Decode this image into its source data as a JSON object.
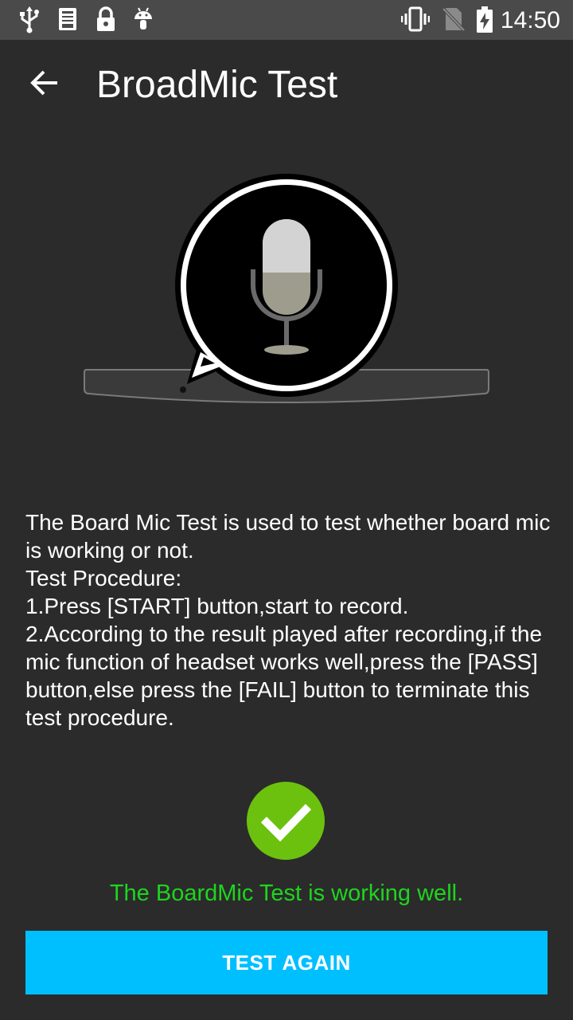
{
  "status_bar": {
    "time": "14:50",
    "icons": [
      "usb-icon",
      "debug-log-icon",
      "lock-icon",
      "android-icon",
      "vibrate-icon",
      "no-sim-icon",
      "battery-charging-icon"
    ]
  },
  "app_bar": {
    "back_icon": "arrow-back-icon",
    "title": "BroadMic Test"
  },
  "illustration": {
    "icon": "microphone-icon"
  },
  "description": {
    "lines": [
      "The Board Mic Test is used to test whether board mic is working or not.",
      "Test Procedure:",
      "1.Press [START] button,start to record.",
      "2.According to the result played after recording,if the mic function of headset works well,press the [PASS] button,else press the [FAIL] button to terminate this test procedure."
    ]
  },
  "result": {
    "icon": "check-circle-icon",
    "message": "The BoardMic Test is working well.",
    "color": "#1ed51e"
  },
  "action": {
    "label": "TEST AGAIN",
    "color": "#00bfff"
  }
}
